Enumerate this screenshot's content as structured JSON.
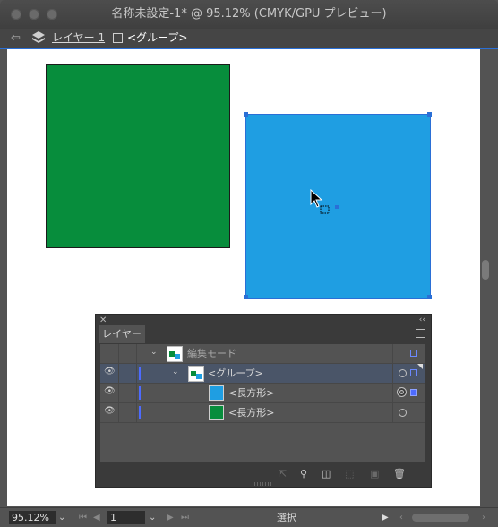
{
  "window": {
    "title": "名称未設定-1* @ 95.12% (CMYK/GPU プレビュー)"
  },
  "breadcrumb": {
    "layer": "レイヤー 1",
    "group": "<グループ>"
  },
  "colors": {
    "green": "#078d3c",
    "blue": "#1f9ee2",
    "selection": "#2a6fd6",
    "layer_color": "#4d6bff"
  },
  "layers_panel": {
    "tab": "レイヤー",
    "rows": [
      {
        "label": "編集モード"
      },
      {
        "label": "<グループ>"
      },
      {
        "label": "<長方形>"
      },
      {
        "label": "<長方形>"
      }
    ]
  },
  "status_bar": {
    "zoom": "95.12%",
    "artboard": "1",
    "tool": "選択"
  }
}
